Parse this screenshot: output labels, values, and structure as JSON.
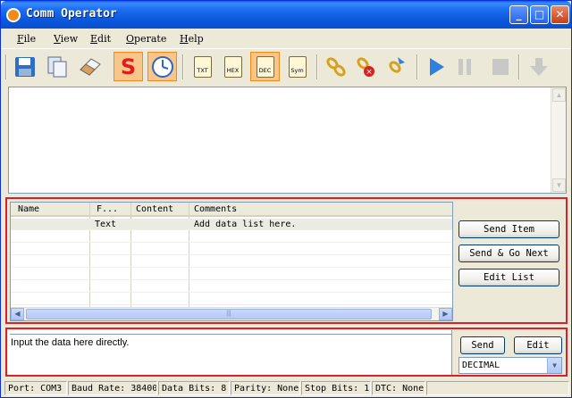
{
  "window": {
    "title": "Comm Operator"
  },
  "menu": [
    "File",
    "View",
    "Edit",
    "Operate",
    "Help"
  ],
  "toolbar": {
    "txt_label": "TXT",
    "hex_label": "HEX",
    "dec_label": "DEC",
    "sym_label": "Sym",
    "s_label": "S"
  },
  "datalist": {
    "columns": [
      "Name",
      "F...",
      "Content",
      "Comments"
    ],
    "rows": [
      {
        "name": "",
        "format": "Text",
        "content": "",
        "comments": "Add data list here."
      }
    ],
    "buttons": {
      "send_item": "Send Item",
      "send_go_next": "Send & Go Next",
      "edit_list": "Edit List"
    }
  },
  "input": {
    "text": "Input the data here directly.",
    "send_label": "Send",
    "edit_label": "Edit",
    "format_value": "DECIMAL"
  },
  "status": {
    "port": "Port: COM3",
    "baud": "Baud Rate: 38400",
    "data_bits": "Data Bits: 8",
    "parity": "Parity: None",
    "stop_bits": "Stop Bits: 1",
    "dtc": "DTC: None"
  },
  "colors": {
    "accent_frame": "#d8222a",
    "titlebar": "#0a5fe0"
  }
}
